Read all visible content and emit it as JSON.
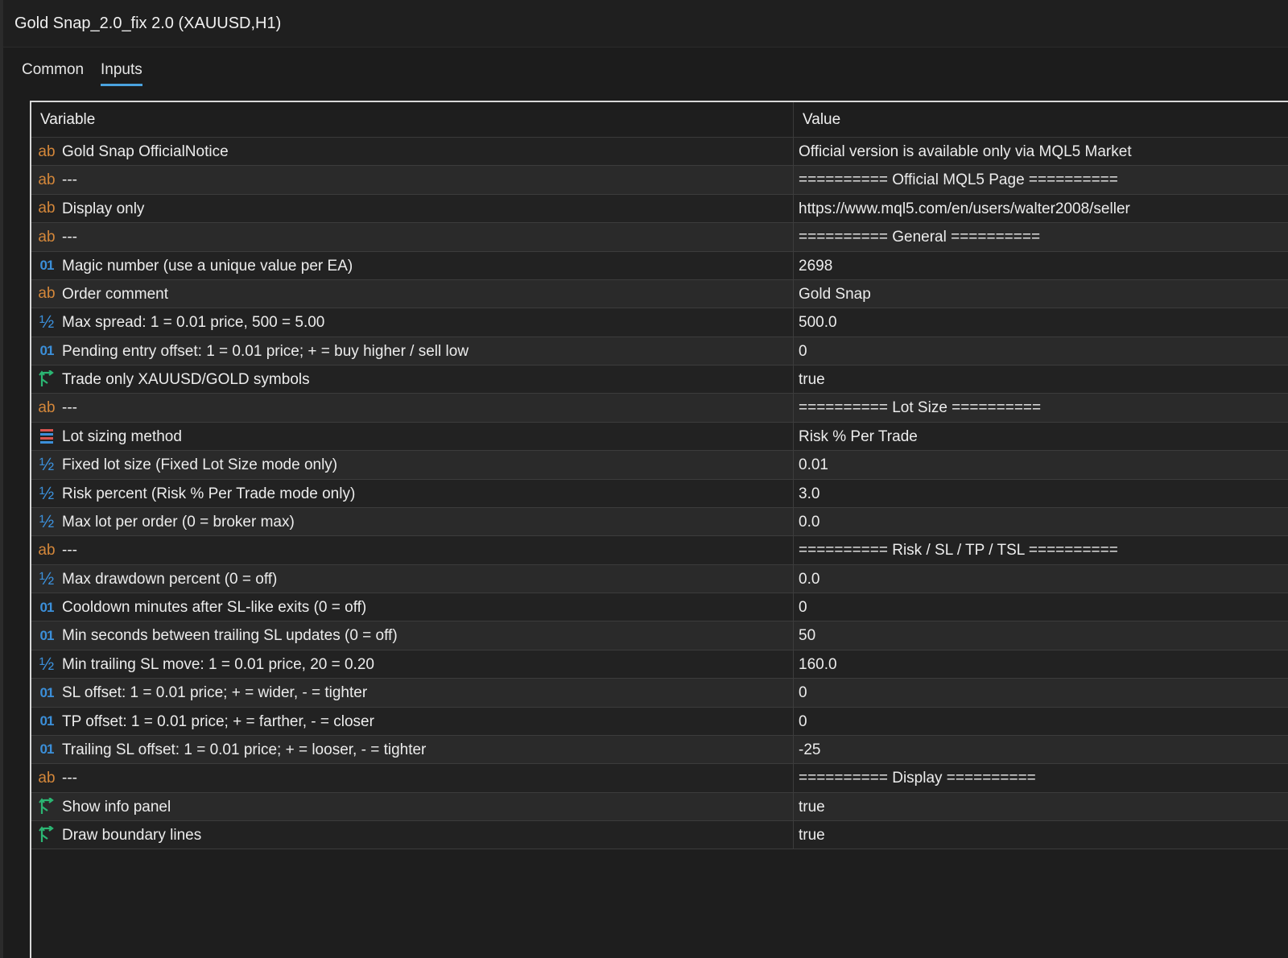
{
  "window": {
    "title": "Gold Snap_2.0_fix 2.0 (XAUUSD,H1)"
  },
  "tabs": [
    {
      "label": "Common",
      "active": false
    },
    {
      "label": "Inputs",
      "active": true
    }
  ],
  "grid": {
    "headers": {
      "variable": "Variable",
      "value": "Value"
    },
    "rows": [
      {
        "type": "ab",
        "variable": "Gold Snap OfficialNotice",
        "value": "Official version is available only via MQL5 Market"
      },
      {
        "type": "ab",
        "variable": "---",
        "value": "========== Official MQL5 Page =========="
      },
      {
        "type": "ab",
        "variable": "Display only",
        "value": "https://www.mql5.com/en/users/walter2008/seller"
      },
      {
        "type": "ab",
        "variable": "---",
        "value": "========== General =========="
      },
      {
        "type": "int",
        "variable": "Magic number (use a unique value per EA)",
        "value": "2698"
      },
      {
        "type": "ab",
        "variable": "Order comment",
        "value": "Gold Snap"
      },
      {
        "type": "double",
        "variable": "Max spread: 1 = 0.01 price, 500 = 5.00",
        "value": "500.0"
      },
      {
        "type": "int",
        "variable": "Pending entry offset: 1 = 0.01 price; + = buy higher / sell low",
        "value": "0"
      },
      {
        "type": "bool",
        "variable": "Trade only XAUUSD/GOLD symbols",
        "value": "true"
      },
      {
        "type": "ab",
        "variable": "---",
        "value": "========== Lot Size =========="
      },
      {
        "type": "enum",
        "variable": "Lot sizing method",
        "value": "Risk % Per Trade"
      },
      {
        "type": "double",
        "variable": "Fixed lot size (Fixed Lot Size mode only)",
        "value": "0.01"
      },
      {
        "type": "double",
        "variable": "Risk percent (Risk % Per Trade mode only)",
        "value": "3.0"
      },
      {
        "type": "double",
        "variable": "Max lot per order (0 = broker max)",
        "value": "0.0"
      },
      {
        "type": "ab",
        "variable": "---",
        "value": "========== Risk / SL / TP / TSL =========="
      },
      {
        "type": "double",
        "variable": "Max drawdown percent (0 = off)",
        "value": "0.0"
      },
      {
        "type": "int",
        "variable": "Cooldown minutes after SL-like exits (0 = off)",
        "value": "0"
      },
      {
        "type": "int",
        "variable": "Min seconds between trailing SL updates (0 = off)",
        "value": "50"
      },
      {
        "type": "double",
        "variable": "Min trailing SL move: 1 = 0.01 price, 20 = 0.20",
        "value": "160.0"
      },
      {
        "type": "int",
        "variable": "SL offset: 1 = 0.01 price; + = wider, - = tighter",
        "value": "0"
      },
      {
        "type": "int",
        "variable": "TP offset: 1 = 0.01 price; + = farther, - = closer",
        "value": "0"
      },
      {
        "type": "int",
        "variable": "Trailing SL offset: 1 = 0.01 price; + = looser, - = tighter",
        "value": "-25"
      },
      {
        "type": "ab",
        "variable": "---",
        "value": "========== Display =========="
      },
      {
        "type": "bool",
        "variable": "Show info panel",
        "value": "true"
      },
      {
        "type": "bool",
        "variable": "Draw boundary lines",
        "value": "true"
      }
    ]
  },
  "icons": {
    "ab": "string-type-icon",
    "int": "integer-type-icon",
    "double": "double-type-icon",
    "bool": "boolean-type-icon",
    "enum": "enum-type-icon"
  },
  "colors": {
    "string_icon": "#d4873a",
    "number_icon": "#3b8fd9",
    "bool_icon": "#2bb673",
    "tab_underline": "#4aa3df"
  }
}
